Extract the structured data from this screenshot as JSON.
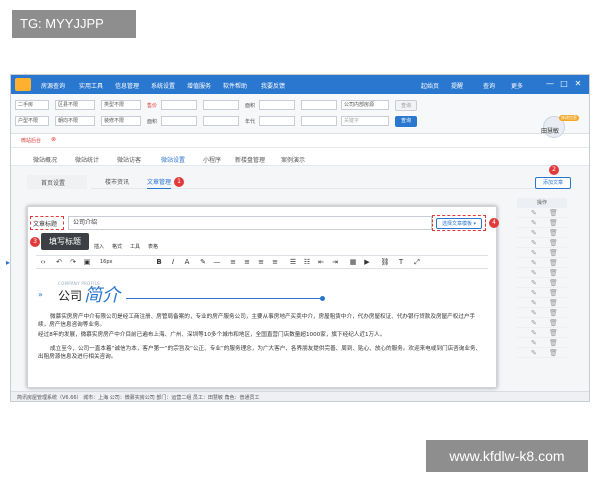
{
  "overlay_tag": "TG: MYYJJPP",
  "watermark": "www.kfdlw-k8.com",
  "colors": {
    "nav": "#2a77cf",
    "accent": "#e03a3a",
    "link": "#2a77cf"
  },
  "nav": {
    "items": [
      "房源查询",
      "实用工具",
      "信息管理",
      "系统设置",
      "增值服务",
      "软件帮助",
      "我要反馈"
    ],
    "right_items": [
      "起始页",
      "提醒",
      "查询",
      "更多"
    ],
    "window_controls": [
      "—",
      "□",
      "✕"
    ]
  },
  "filter": {
    "row1": {
      "select1": "二手房",
      "select2": "区县不限",
      "select3": "类型不限",
      "price_label": "售价",
      "area_label": "面积",
      "select4": "公司内部房源",
      "query_label": "查询"
    },
    "row2": {
      "select1": "户型不限",
      "select2": "朝向不限",
      "select3": "装修不限",
      "area_label": "面积",
      "year_label": "年代",
      "keyword_placeholder": "关键字",
      "query_label": "查询"
    },
    "user_name": "田慧敏",
    "user_badge": "修改信息"
  },
  "breadcrumb": {
    "label": "微站后台"
  },
  "tabs_main": [
    "微站概况",
    "微站统计",
    "微站访客",
    "微站设置",
    "小程序",
    "新楼盘管理",
    "案例演示"
  ],
  "tabs_main_active": "微站设置",
  "left_tab": "首页设置",
  "tabs_sub": [
    "楼市资讯",
    "文章管理"
  ],
  "tabs_sub_active": "文章管理",
  "add_article_button": "添加文章",
  "table": {
    "header": "操作",
    "row_count": 15,
    "edit_icon": "✎",
    "delete_icon": "🗑"
  },
  "markers": [
    "1",
    "2",
    "3",
    "4"
  ],
  "dialog": {
    "title_label": "文章标题",
    "title_value": "公司介绍",
    "template_button": "选择文章模板 ▾",
    "tooltip": "填写标题",
    "menu": [
      "插入",
      "格式",
      "工具",
      "表格"
    ],
    "font_size": "16px",
    "heading_small": "COMPANY PROFILE",
    "heading_company": "公司",
    "heading_stylized": "简介",
    "paragraphs": [
      "微慕实房房产中介有限公司是经工商注册、房管局备案的，专业的房产服务公司，主要从事房地产买卖中介，房屋租赁中介，代办房屋权证、代办银行贷款及房屋产权过户手续，房产信息咨询等业务。",
      "经过8年的发展，微慕实房房产中介目前已遍布上海、广州、深圳等10多个城市和地区，全国直营门店数量超1000家，旗下经纪人近1万人。",
      "成立至今，公司一直本着“诚信为本，客户第一”的宗旨及“公正、专业”的服务理念，为广大客户、各界朋友提供完善、周到、贴心、放心的服务。欢迎来电或到门店咨询业务、出租房源信息及进行相关咨询。"
    ]
  },
  "status_bar": {
    "text": "简讯房屋管理系统（V6.66）   城市：上海   公司：微慕实房公司   部门：运营二组   员工：田慧敏   角色：普通员工"
  }
}
